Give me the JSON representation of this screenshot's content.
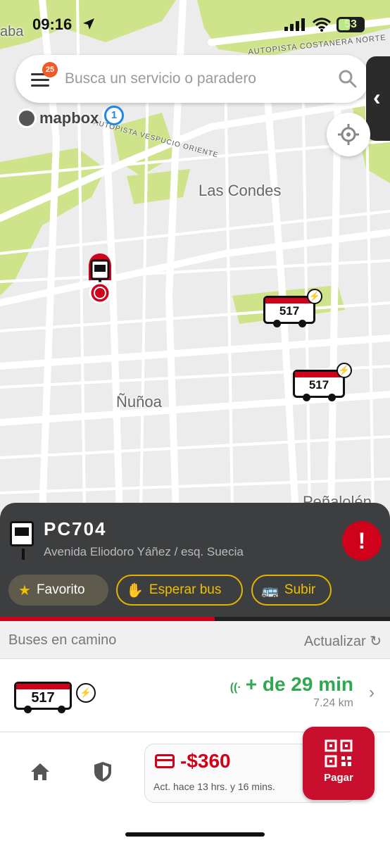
{
  "status_bar": {
    "time": "09:16",
    "battery": "53"
  },
  "map": {
    "labels": {
      "las_condes": "Las Condes",
      "nunoa": "Ñuñoa",
      "penalolen": "Peñalolén",
      "edge": "aba"
    },
    "roads": {
      "costanera": "AUTOPISTA COSTANERA NORTE",
      "vespucio": "AUTOPISTA VESPUCIO ORIENTE"
    },
    "route_badge": "1",
    "attribution": "mapbox",
    "buses": [
      {
        "number": "517"
      },
      {
        "number": "517"
      }
    ]
  },
  "search": {
    "placeholder": "Busca un servicio o paradero",
    "notification_count": "25"
  },
  "stop": {
    "code": "PC704",
    "address": "Avenida Eliodoro Yáñez / esq. Suecia",
    "alert_symbol": "!",
    "actions": {
      "favorite": "Favorito",
      "wait": "Esperar bus",
      "board": "Subir"
    },
    "progress": 0.55
  },
  "buses_section": {
    "title": "Buses en camino",
    "refresh": "Actualizar",
    "refresh_icon": "↻",
    "items": [
      {
        "number": "517",
        "eta": "+ de 29 min",
        "distance": "7.24 km"
      }
    ]
  },
  "wallet": {
    "balance": "-$360",
    "updated": "Act. hace 13 hrs. y 16 mins.",
    "pay_label": "Pagar"
  },
  "colors": {
    "brand_red": "#d0021b",
    "accent_yellow": "#f0c000",
    "eta_green": "#2fa84f",
    "panel": "#3c3e40"
  }
}
